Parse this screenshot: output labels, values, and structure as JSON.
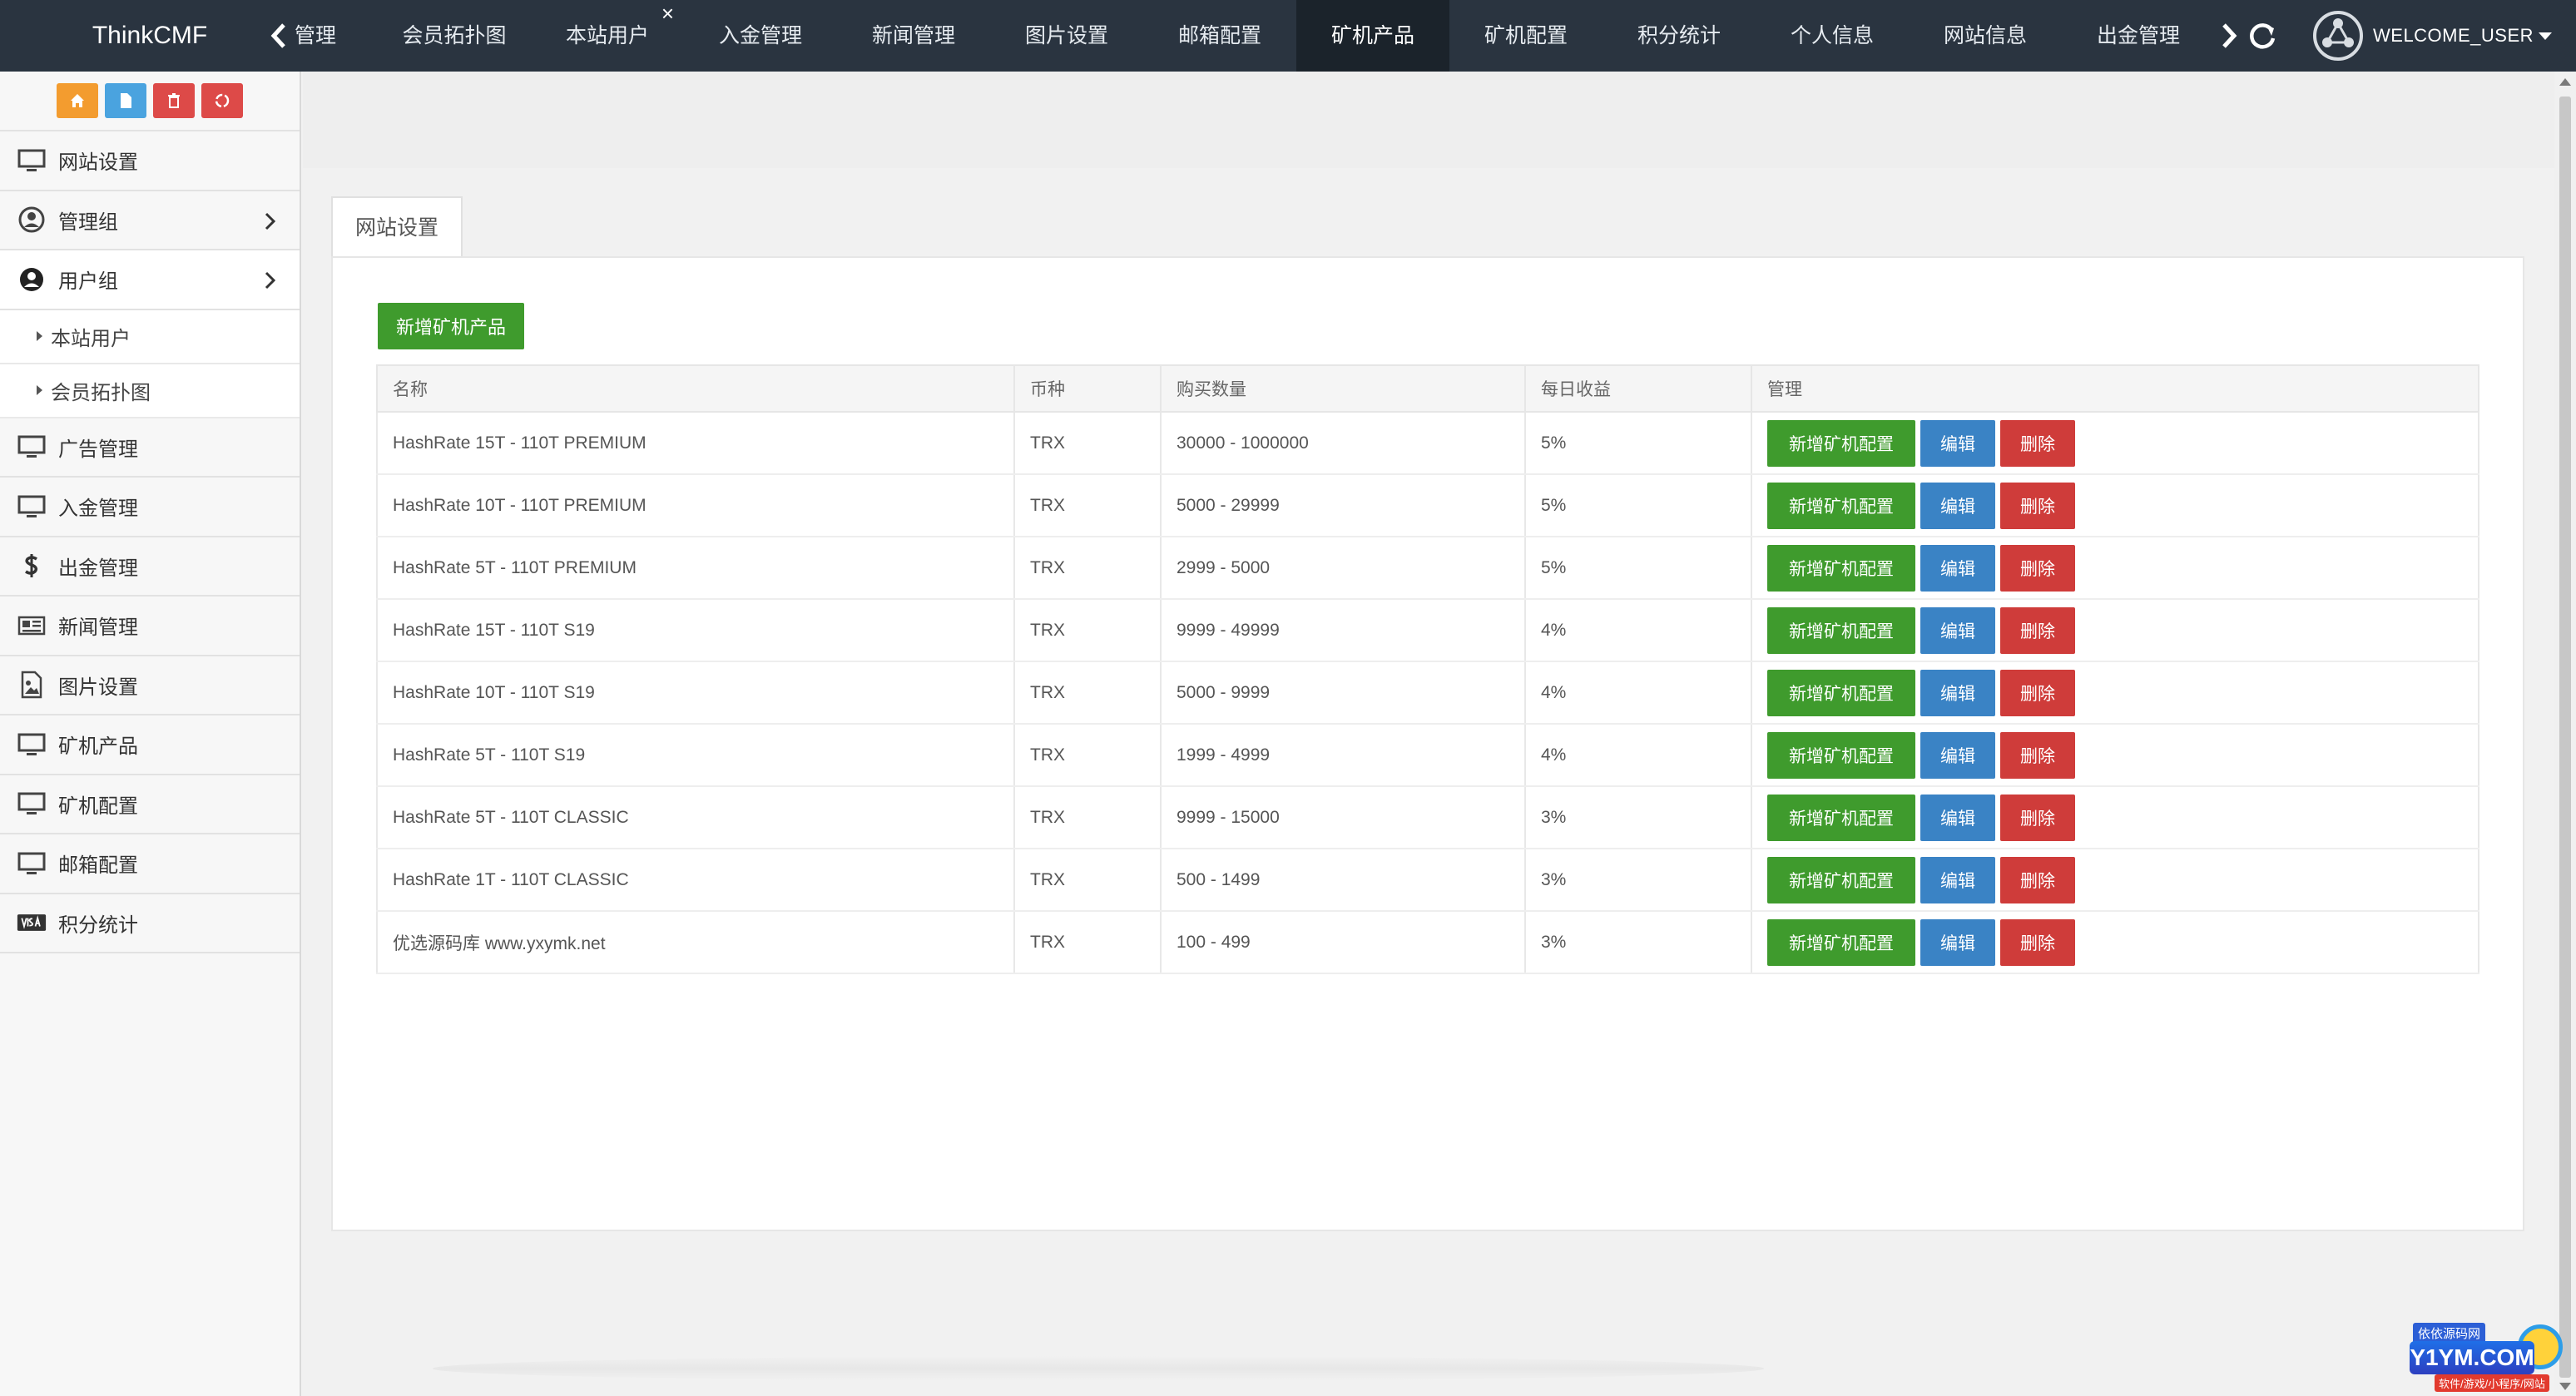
{
  "brand": "ThinkCMF",
  "nav": {
    "tabs": [
      {
        "label": "管理"
      },
      {
        "label": "会员拓扑图"
      },
      {
        "label": "本站用户"
      },
      {
        "label": "入金管理"
      },
      {
        "label": "新闻管理"
      },
      {
        "label": "图片设置"
      },
      {
        "label": "邮箱配置"
      },
      {
        "label": "矿机产品",
        "active": true
      },
      {
        "label": "矿机配置"
      },
      {
        "label": "积分统计"
      },
      {
        "label": "个人信息"
      },
      {
        "label": "网站信息"
      },
      {
        "label": "出金管理"
      }
    ],
    "close_glyph": "×",
    "user": "WELCOME_USER"
  },
  "sidebar": {
    "shortcuts": [
      {
        "icon": "home-icon",
        "color": "#f39c2f"
      },
      {
        "icon": "document-icon",
        "color": "#4aa3df"
      },
      {
        "icon": "trash-icon",
        "color": "#dd4a48"
      },
      {
        "icon": "recycle-icon",
        "color": "#dd4a48"
      }
    ],
    "items": [
      {
        "label": "网站设置",
        "icon": "monitor-icon"
      },
      {
        "label": "管理组",
        "icon": "user-circle-icon",
        "chevron": true
      },
      {
        "label": "用户组",
        "icon": "user-icon",
        "chevron": true,
        "open": true,
        "children": [
          {
            "label": "本站用户"
          },
          {
            "label": "会员拓扑图"
          }
        ]
      },
      {
        "label": "广告管理",
        "icon": "monitor-icon"
      },
      {
        "label": "入金管理",
        "icon": "monitor-icon"
      },
      {
        "label": "出金管理",
        "icon": "dollar-icon"
      },
      {
        "label": "新闻管理",
        "icon": "newspaper-icon"
      },
      {
        "label": "图片设置",
        "icon": "image-icon"
      },
      {
        "label": "矿机产品",
        "icon": "monitor-icon"
      },
      {
        "label": "矿机配置",
        "icon": "monitor-icon"
      },
      {
        "label": "邮箱配置",
        "icon": "monitor-icon"
      },
      {
        "label": "积分统计",
        "icon": "visa-icon"
      }
    ]
  },
  "content": {
    "tab_label": "网站设置",
    "add_button": "新增矿机产品",
    "table": {
      "headers": [
        "名称",
        "币种",
        "购买数量",
        "每日收益",
        "管理"
      ],
      "rows": [
        {
          "name": "HashRate 15T - 110T PREMIUM",
          "coin": "TRX",
          "qty": "30000 - 1000000",
          "rate": "5%"
        },
        {
          "name": "HashRate 10T - 110T PREMIUM",
          "coin": "TRX",
          "qty": "5000 - 29999",
          "rate": "5%"
        },
        {
          "name": "HashRate 5T - 110T PREMIUM",
          "coin": "TRX",
          "qty": "2999 - 5000",
          "rate": "5%"
        },
        {
          "name": "HashRate 15T - 110T S19",
          "coin": "TRX",
          "qty": "9999 - 49999",
          "rate": "4%"
        },
        {
          "name": "HashRate 10T - 110T S19",
          "coin": "TRX",
          "qty": "5000 - 9999",
          "rate": "4%"
        },
        {
          "name": "HashRate 5T - 110T S19",
          "coin": "TRX",
          "qty": "1999 - 4999",
          "rate": "4%"
        },
        {
          "name": "HashRate 5T - 110T CLASSIC",
          "coin": "TRX",
          "qty": "9999 - 15000",
          "rate": "3%"
        },
        {
          "name": "HashRate 1T - 110T CLASSIC",
          "coin": "TRX",
          "qty": "500 - 1499",
          "rate": "3%"
        },
        {
          "name": "优选源码库 www.yxymk.net",
          "coin": "TRX",
          "qty": "100 - 499",
          "rate": "3%"
        }
      ],
      "actions": {
        "config": "新增矿机配置",
        "edit": "编辑",
        "delete": "删除"
      }
    }
  },
  "watermark": {
    "top": "依依源码网",
    "main": "Y1YM.COM",
    "sub": "软件/游戏/小程序/网站"
  },
  "colors": {
    "topbar": "#2a3440",
    "active_tab": "#1b232b",
    "green": "#3f9b2d",
    "blue": "#3a83c5",
    "red": "#cf3c3a"
  }
}
